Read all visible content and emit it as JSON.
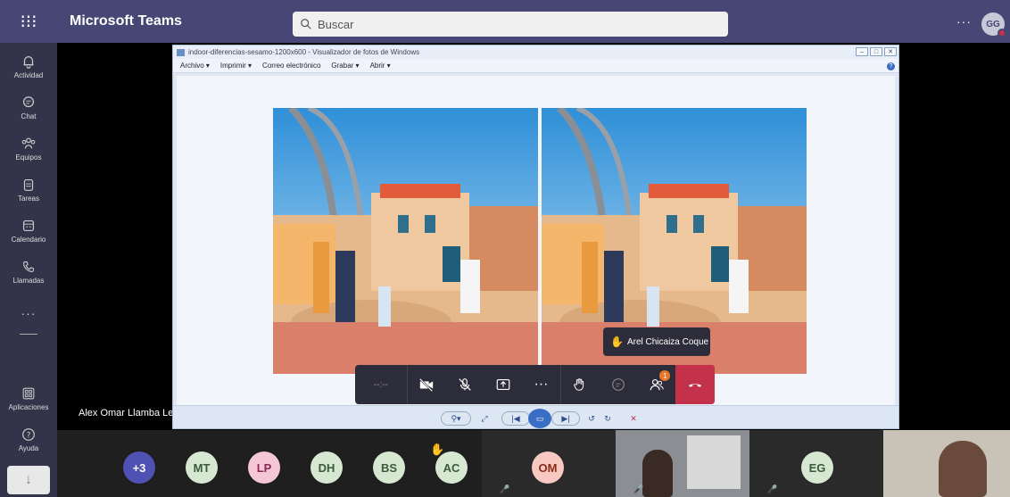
{
  "app": {
    "title": "Microsoft Teams"
  },
  "search": {
    "placeholder": "Buscar"
  },
  "topbar": {
    "more": "···",
    "user_initials": "GG"
  },
  "rail": {
    "items": [
      {
        "label": "Actividad",
        "icon": "bell-icon"
      },
      {
        "label": "Chat",
        "icon": "chat-icon"
      },
      {
        "label": "Equipos",
        "icon": "teams-icon"
      },
      {
        "label": "Tareas",
        "icon": "tasks-icon"
      },
      {
        "label": "Calendario",
        "icon": "calendar-icon"
      },
      {
        "label": "Llamadas",
        "icon": "phone-icon"
      },
      {
        "label": "Aplicaciones",
        "icon": "apps-icon"
      },
      {
        "label": "Ayuda",
        "icon": "help-icon"
      }
    ],
    "more": "···"
  },
  "stage": {
    "presenter_name": "Alex Omar Llamba Lema"
  },
  "viewer": {
    "title": "indoor-diferencias-sesamo-1200x600 - Visualizador de fotos de Windows",
    "menu": [
      "Archivo ▾",
      "Imprimir ▾",
      "Correo electrónico",
      "Grabar ▾",
      "Abrir ▾"
    ]
  },
  "callbar": {
    "timer": "--:--",
    "participants_badge": "1"
  },
  "tooltip": {
    "name": "Arel Chicaiza Coque"
  },
  "participants": [
    {
      "initials": "+3",
      "bg": "#4f52b2",
      "fg": "#ffffff"
    },
    {
      "initials": "MT",
      "bg": "#d6e8d2",
      "fg": "#3a5a3a"
    },
    {
      "initials": "LP",
      "bg": "#f4c6d6",
      "fg": "#8a2a52"
    },
    {
      "initials": "DH",
      "bg": "#d6e8d2",
      "fg": "#3a5a3a"
    },
    {
      "initials": "BS",
      "bg": "#d6e8d2",
      "fg": "#3a5a3a"
    },
    {
      "initials": "AC",
      "bg": "#d6e8d2",
      "fg": "#3a5a3a"
    },
    {
      "initials": "OM",
      "bg": "#f7c9c0",
      "fg": "#8a2a1a"
    },
    {
      "initials": "EG",
      "bg": "#d6e8d2",
      "fg": "#3a5a3a"
    }
  ]
}
